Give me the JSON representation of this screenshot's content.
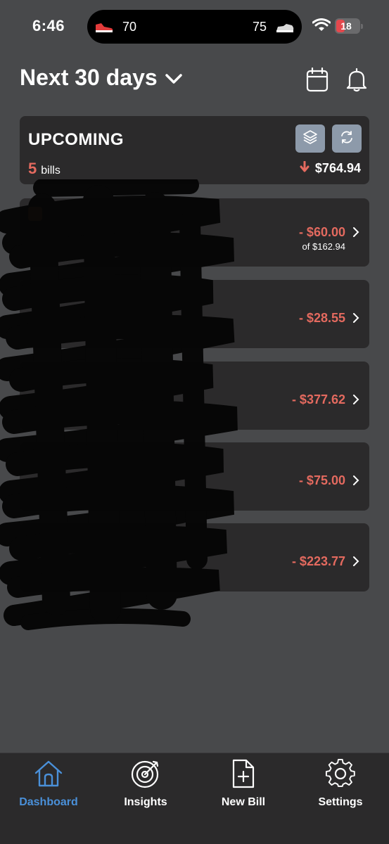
{
  "status_bar": {
    "time": "6:46",
    "activity_left_value": "70",
    "activity_right_value": "75",
    "battery_level": "18"
  },
  "header": {
    "title": "Next 30 days"
  },
  "summary": {
    "label": "UPCOMING",
    "bill_count": "5",
    "bill_count_suffix": "bills",
    "total": "$764.94"
  },
  "bills": [
    {
      "amount": "- $60.00",
      "of_total": "of $162.94"
    },
    {
      "amount": "- $28.55",
      "of_total": ""
    },
    {
      "amount": "- $377.62",
      "of_total": ""
    },
    {
      "amount": "- $75.00",
      "of_total": ""
    },
    {
      "amount": "- $223.77",
      "of_total": ""
    }
  ],
  "tabs": [
    {
      "label": "Dashboard",
      "icon": "home-icon",
      "active": true
    },
    {
      "label": "Insights",
      "icon": "target-icon",
      "active": false
    },
    {
      "label": "New Bill",
      "icon": "new-document-icon",
      "active": false
    },
    {
      "label": "Settings",
      "icon": "gear-icon",
      "active": false
    }
  ],
  "colors": {
    "background": "#48494b",
    "card": "#2b2a2b",
    "negative": "#e46a5f",
    "accent": "#4a90d9"
  }
}
